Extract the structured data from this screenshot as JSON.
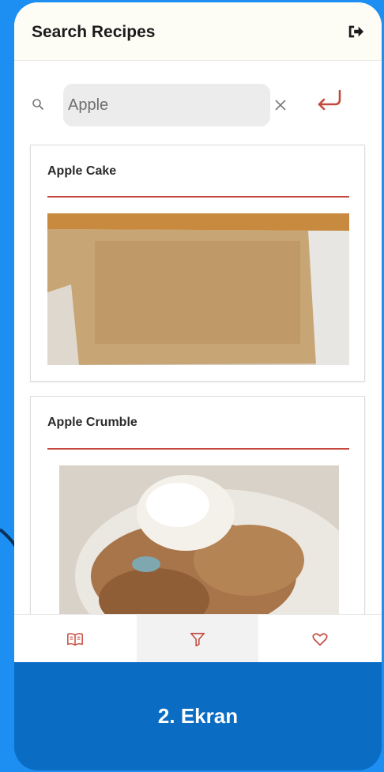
{
  "app": {
    "title": "Search Recipes"
  },
  "search": {
    "value": "Apple"
  },
  "recipes": [
    {
      "title": "Apple Cake"
    },
    {
      "title": "Apple Crumble"
    }
  ],
  "colors": {
    "accent": "#c4493d",
    "background": "#1d8ff2",
    "label_bar": "#0b6cc3"
  },
  "icons": {
    "logout": "logout-icon",
    "search": "search-icon",
    "clear": "close-icon",
    "return": "return-arrow-icon",
    "nav": [
      "open-book-icon",
      "filter-icon",
      "heart-icon"
    ]
  },
  "caption": "2. Ekran"
}
